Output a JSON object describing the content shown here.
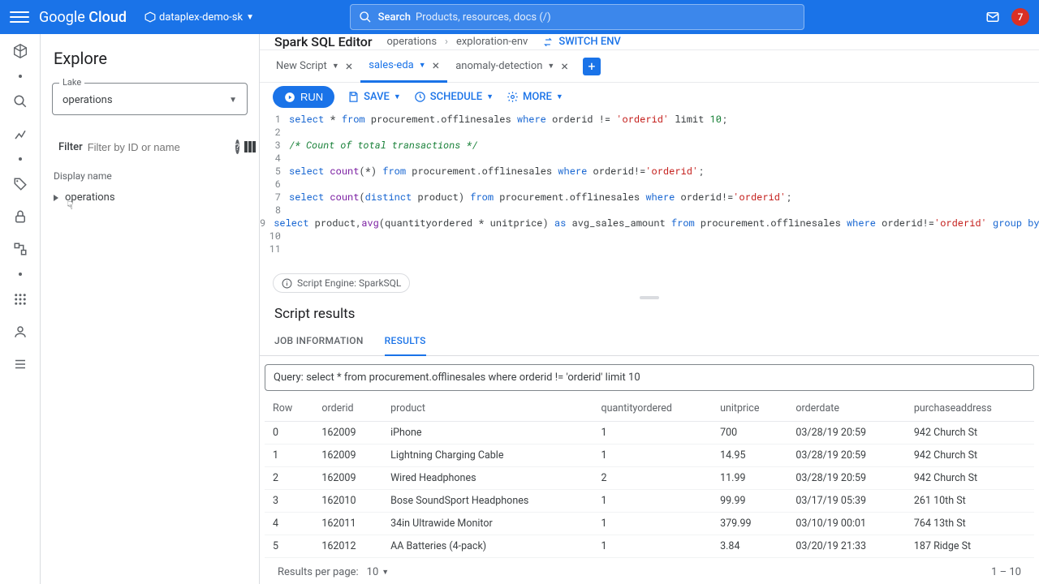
{
  "header": {
    "logo_prefix": "Google",
    "logo_suffix": "Cloud",
    "project": "dataplex-demo-sk",
    "search_button": "Search",
    "search_placeholder": "Products, resources, docs (/)",
    "notification_count": "7"
  },
  "sidebar": {
    "title": "Explore",
    "lake_label": "Lake",
    "lake_value": "operations",
    "filter_label": "Filter",
    "filter_placeholder": "Filter by ID or name",
    "display_name_header": "Display name",
    "tree_root": "operations"
  },
  "main": {
    "title": "Spark SQL Editor",
    "breadcrumbs": {
      "lake": "operations",
      "env": "exploration-env"
    },
    "switch_env": "SWITCH ENV"
  },
  "tabs": [
    {
      "label": "New Script"
    },
    {
      "label": "sales-eda"
    },
    {
      "label": "anomaly-detection"
    }
  ],
  "toolbar": {
    "run": "RUN",
    "save": "SAVE",
    "schedule": "SCHEDULE",
    "more": "MORE"
  },
  "engine": {
    "label": "Script Engine: SparkSQL"
  },
  "results": {
    "title": "Script results",
    "tab_job": "JOB INFORMATION",
    "tab_results": "RESULTS",
    "query_prefix": "Query: ",
    "query_text": "select * from procurement.offlinesales where orderid != 'orderid' limit 10",
    "columns": [
      "Row",
      "orderid",
      "product",
      "quantityordered",
      "unitprice",
      "orderdate",
      "purchaseaddress"
    ],
    "rows": [
      [
        "0",
        "162009",
        "iPhone",
        "1",
        "700",
        "03/28/19 20:59",
        "942 Church St"
      ],
      [
        "1",
        "162009",
        "Lightning Charging Cable",
        "1",
        "14.95",
        "03/28/19 20:59",
        "942 Church St"
      ],
      [
        "2",
        "162009",
        "Wired Headphones",
        "2",
        "11.99",
        "03/28/19 20:59",
        "942 Church St"
      ],
      [
        "3",
        "162010",
        "Bose SoundSport Headphones",
        "1",
        "99.99",
        "03/17/19 05:39",
        "261 10th St"
      ],
      [
        "4",
        "162011",
        "34in Ultrawide Monitor",
        "1",
        "379.99",
        "03/10/19 00:01",
        "764 13th St"
      ],
      [
        "5",
        "162012",
        "AA Batteries (4-pack)",
        "1",
        "3.84",
        "03/20/19 21:33",
        "187 Ridge St"
      ]
    ],
    "pager_label": "Results per page:",
    "pager_value": "10",
    "pager_range": "1 – 10"
  },
  "code_lines": [
    {
      "n": "1",
      "html": "<span class='kw'>select</span> * <span class='kw'>from</span> procurement.offlinesales <span class='kw'>where</span> orderid != <span class='str'>'orderid'</span> limit <span class='num'>10</span>;"
    },
    {
      "n": "2",
      "html": ""
    },
    {
      "n": "3",
      "html": "<span class='cmt'>/* Count of total transactions */</span>"
    },
    {
      "n": "4",
      "html": ""
    },
    {
      "n": "5",
      "html": "<span class='kw'>select</span> <span class='fn'>count</span>(*) <span class='kw'>from</span> procurement.offlinesales <span class='kw'>where</span> orderid!=<span class='str'>'orderid'</span>;"
    },
    {
      "n": "6",
      "html": ""
    },
    {
      "n": "7",
      "html": "<span class='kw'>select</span> <span class='fn'>count</span>(<span class='kw'>distinct</span> product) <span class='kw'>from</span> procurement.offlinesales <span class='kw'>where</span> orderid!=<span class='str'>'orderid'</span>;"
    },
    {
      "n": "8",
      "html": ""
    },
    {
      "n": "9",
      "html": "<span class='kw'>select</span> product,<span class='fn'>avg</span>(quantityordered * unitprice) <span class='kw'>as</span> avg_sales_amount <span class='kw'>from</span> procurement.offlinesales <span class='kw'>where</span> orderid!=<span class='str'>'orderid'</span> <span class='kw'>group by</span> product <span class='kw'>order by</span> avg_sales"
    },
    {
      "n": "10",
      "html": ""
    },
    {
      "n": "11",
      "html": ""
    }
  ]
}
